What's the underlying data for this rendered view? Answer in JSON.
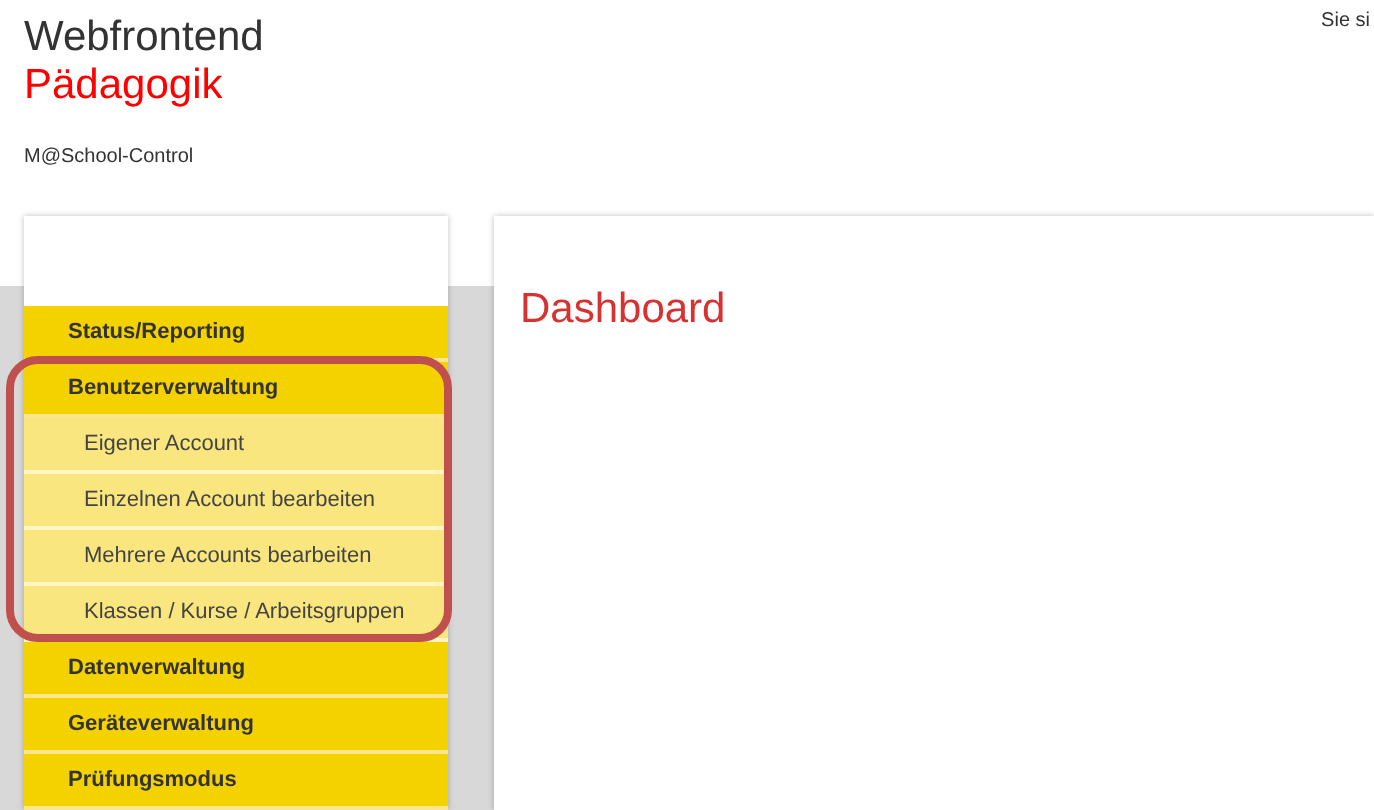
{
  "header": {
    "title": "Webfrontend",
    "subtitle": "Pädagogik",
    "product": "M@School-Control",
    "user_note": "Sie si"
  },
  "sidebar": {
    "items": [
      {
        "label": "Status/Reporting",
        "expanded": false,
        "highlighted": false
      },
      {
        "label": "Benutzerverwaltung",
        "expanded": true,
        "highlighted": true,
        "children": [
          {
            "label": "Eigener Account"
          },
          {
            "label": "Einzelnen Account bearbeiten"
          },
          {
            "label": "Mehrere Accounts bearbeiten"
          },
          {
            "label": "Klassen / Kurse / Arbeitsgruppen"
          }
        ]
      },
      {
        "label": "Datenverwaltung",
        "expanded": false,
        "highlighted": false
      },
      {
        "label": "Geräteverwaltung",
        "expanded": false,
        "highlighted": false
      },
      {
        "label": "Prüfungsmodus",
        "expanded": false,
        "highlighted": false
      }
    ]
  },
  "main": {
    "heading": "Dashboard"
  }
}
